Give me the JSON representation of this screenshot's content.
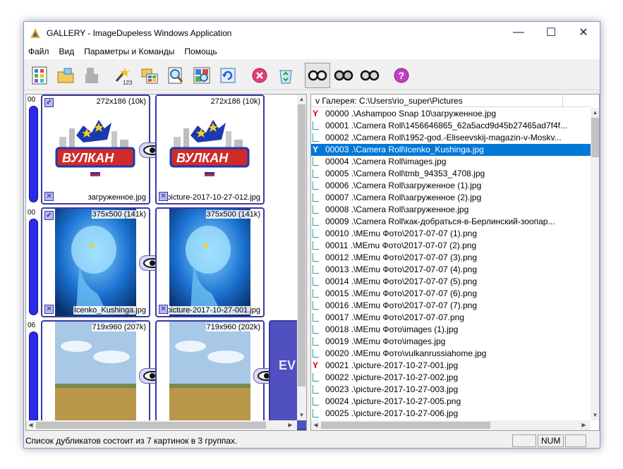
{
  "window": {
    "title": "GALLERY - ImageDupeless Windows Application",
    "minimize": "—",
    "maximize": "☐",
    "close": "✕"
  },
  "menu": [
    "Файл",
    "Вид",
    "Параметры и Команды",
    "Помощь"
  ],
  "toolbar": {
    "icons": [
      "grid-icon",
      "open-folder-icon",
      "disabled-icon",
      "magic-wand-icon",
      "folders-icon",
      "zoom-page-icon",
      "zoom-grid-icon",
      "refresh-icon",
      "delete-icon",
      "recycle-icon",
      "glasses-icon",
      "glasses-icon",
      "glasses-icon",
      "help-icon"
    ],
    "wand_label": "123"
  },
  "groups": [
    {
      "id": "00",
      "color": "#2a2ae8",
      "items": [
        {
          "size": "272x186 (10k)",
          "name": "загруженное.jpg",
          "checked": true,
          "image": "vulkan-logo"
        },
        {
          "size": "272x186 (10k)",
          "name": "picture-2017-10-27-012.jpg",
          "checked": false,
          "image": "vulkan-logo"
        }
      ]
    },
    {
      "id": "00",
      "color": "#2a2ae8",
      "items": [
        {
          "size": "375x500 (141k)",
          "name": "Icenko_Kushinga.jpg",
          "checked": true,
          "image": "blue-brain"
        },
        {
          "size": "375x500 (141k)",
          "name": "picture-2017-10-27-001.jpg",
          "checked": false,
          "image": "blue-brain"
        }
      ]
    },
    {
      "id": "06",
      "color": "#2a2ae8",
      "items": [
        {
          "size": "719x960 (207k)",
          "name": "",
          "checked": false,
          "image": "field"
        },
        {
          "size": "719x960 (202k)",
          "name": "",
          "checked": false,
          "image": "field"
        }
      ],
      "partial_text": "EV"
    }
  ],
  "list": {
    "header": "v Галерея: C:\\Users\\rio_super\\Pictures",
    "rows": [
      {
        "num": "00000",
        "path": ".\\Ashampoo Snap 10\\загруженное.jpg",
        "mark": "Y",
        "selected": false
      },
      {
        "num": "00001",
        "path": ".\\Camera Roll\\1456646865_62a5acd9d45b27465ad7f4f...",
        "mark": "",
        "selected": false
      },
      {
        "num": "00002",
        "path": ".\\Camera Roll\\1952-god.-Eliseevskij-magazin-v-Moskv...",
        "mark": "",
        "selected": false
      },
      {
        "num": "00003",
        "path": ".\\Camera Roll\\Icenko_Kushinga.jpg",
        "mark": "Y",
        "selected": true
      },
      {
        "num": "00004",
        "path": ".\\Camera Roll\\images.jpg",
        "mark": "",
        "selected": false
      },
      {
        "num": "00005",
        "path": ".\\Camera Roll\\tmb_94353_4708.jpg",
        "mark": "",
        "selected": false
      },
      {
        "num": "00006",
        "path": ".\\Camera Roll\\загруженное (1).jpg",
        "mark": "",
        "selected": false
      },
      {
        "num": "00007",
        "path": ".\\Camera Roll\\загруженное (2).jpg",
        "mark": "",
        "selected": false
      },
      {
        "num": "00008",
        "path": ".\\Camera Roll\\загруженное.jpg",
        "mark": "",
        "selected": false
      },
      {
        "num": "00009",
        "path": ".\\Camera Roll\\как-добраться-в-Берлинский-зоопар...",
        "mark": "",
        "selected": false
      },
      {
        "num": "00010",
        "path": ".\\MEmu Фото\\2017-07-07 (1).png",
        "mark": "",
        "selected": false
      },
      {
        "num": "00011",
        "path": ".\\MEmu Фото\\2017-07-07 (2).png",
        "mark": "",
        "selected": false
      },
      {
        "num": "00012",
        "path": ".\\MEmu Фото\\2017-07-07 (3).png",
        "mark": "",
        "selected": false
      },
      {
        "num": "00013",
        "path": ".\\MEmu Фото\\2017-07-07 (4).png",
        "mark": "",
        "selected": false
      },
      {
        "num": "00014",
        "path": ".\\MEmu Фото\\2017-07-07 (5).png",
        "mark": "",
        "selected": false
      },
      {
        "num": "00015",
        "path": ".\\MEmu Фото\\2017-07-07 (6).png",
        "mark": "",
        "selected": false
      },
      {
        "num": "00016",
        "path": ".\\MEmu Фото\\2017-07-07 (7).png",
        "mark": "",
        "selected": false
      },
      {
        "num": "00017",
        "path": ".\\MEmu Фото\\2017-07-07.png",
        "mark": "",
        "selected": false
      },
      {
        "num": "00018",
        "path": ".\\MEmu Фото\\images (1).jpg",
        "mark": "",
        "selected": false
      },
      {
        "num": "00019",
        "path": ".\\MEmu Фото\\images.jpg",
        "mark": "",
        "selected": false
      },
      {
        "num": "00020",
        "path": ".\\MEmu Фото\\vulkanrussiahome.jpg",
        "mark": "",
        "selected": false
      },
      {
        "num": "00021",
        "path": ".\\picture-2017-10-27-001.jpg",
        "mark": "Y",
        "selected": false
      },
      {
        "num": "00022",
        "path": ".\\picture-2017-10-27-002.jpg",
        "mark": "",
        "selected": false
      },
      {
        "num": "00023",
        "path": ".\\picture-2017-10-27-003.jpg",
        "mark": "",
        "selected": false
      },
      {
        "num": "00024",
        "path": ".\\picture-2017-10-27-005.png",
        "mark": "",
        "selected": false
      },
      {
        "num": "00025",
        "path": ".\\picture-2017-10-27-006.jpg",
        "mark": "",
        "selected": false
      }
    ]
  },
  "status": {
    "text": "Список дубликатов состоит из 7 картинок в 3 группах.",
    "num": "NUM"
  }
}
